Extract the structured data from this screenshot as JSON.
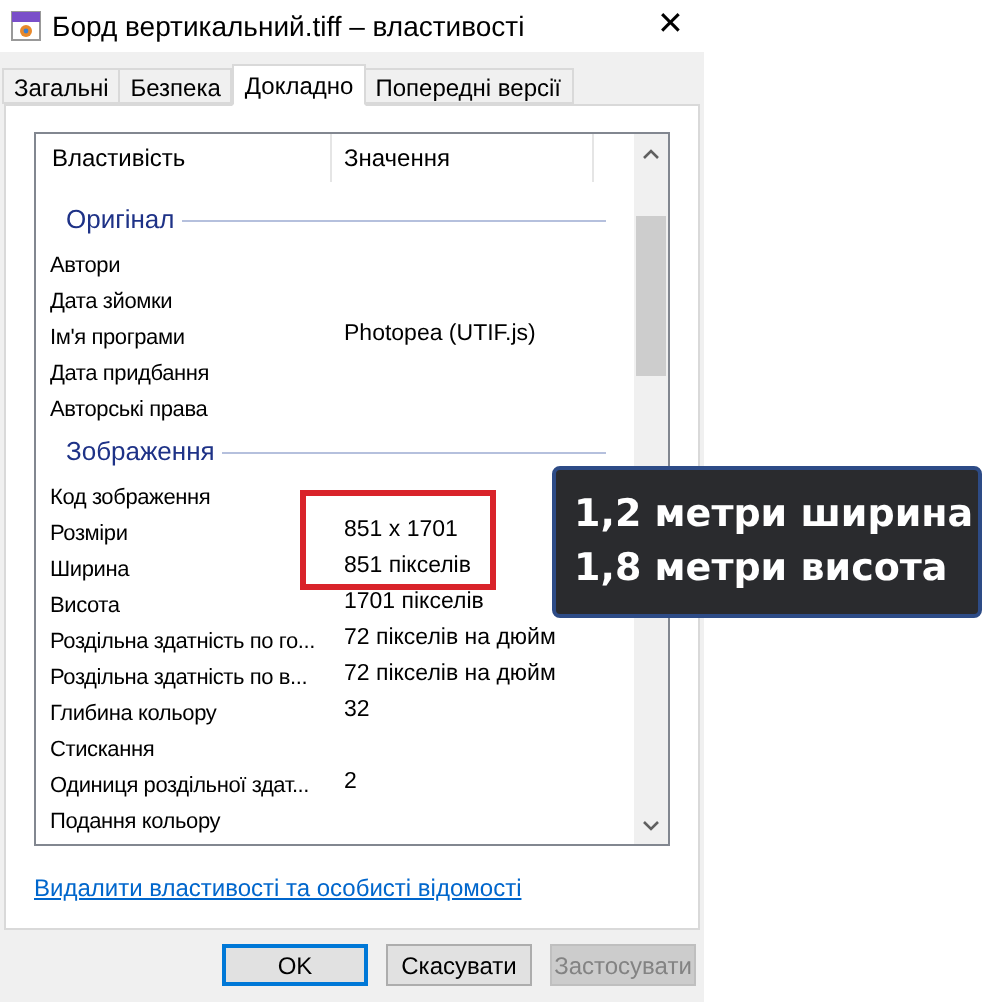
{
  "window": {
    "title": "Борд вертикальний.tiff – властивості",
    "close": "✕"
  },
  "tabs": [
    {
      "label": "Загальні",
      "selected": false
    },
    {
      "label": "Безпека",
      "selected": false
    },
    {
      "label": "Докладно",
      "selected": true
    },
    {
      "label": "Попередні версії",
      "selected": false
    }
  ],
  "table": {
    "columns": [
      "Властивість",
      "Значення"
    ],
    "rows": [
      {
        "kind": "group",
        "label": "Оригінал"
      },
      {
        "kind": "property",
        "name": "Автори"
      },
      {
        "kind": "property",
        "name": "Дата зйомки"
      },
      {
        "kind": "property",
        "name": "Ім'я програми",
        "value": "Photopea (UTIF.js)"
      },
      {
        "kind": "property",
        "name": "Дата придбання"
      },
      {
        "kind": "property",
        "name": "Авторські права"
      },
      {
        "kind": "group",
        "label": "Зображення"
      },
      {
        "kind": "property",
        "name": "Код зображення"
      },
      {
        "kind": "property",
        "name": "Розміри",
        "value": "851 x 1701"
      },
      {
        "kind": "property",
        "name": "Ширина",
        "value": "851 пікселів"
      },
      {
        "kind": "property",
        "name": "Висота",
        "value": "1701 пікселів"
      },
      {
        "kind": "property",
        "name": "Роздільна здатність по го...",
        "value": "72 пікселів на дюйм"
      },
      {
        "kind": "property",
        "name": "Роздільна здатність по в...",
        "value": "72 пікселів на дюйм"
      },
      {
        "kind": "property",
        "name": "Глибина кольору",
        "value": "32"
      },
      {
        "kind": "property",
        "name": "Стискання"
      },
      {
        "kind": "property",
        "name": "Одиниця роздільної здат...",
        "value": "2"
      },
      {
        "kind": "property",
        "name": "Подання кольору"
      }
    ]
  },
  "link": "Видалити властивості та особисті відомості",
  "buttons": [
    {
      "label": "OK",
      "default": true,
      "disabled": false
    },
    {
      "label": "Скасувати",
      "default": false,
      "disabled": false
    },
    {
      "label": "Застосувати",
      "default": false,
      "disabled": true
    }
  ],
  "annotation": {
    "lines": [
      "1,2 метри ширина",
      "1,8 метри висота"
    ]
  }
}
